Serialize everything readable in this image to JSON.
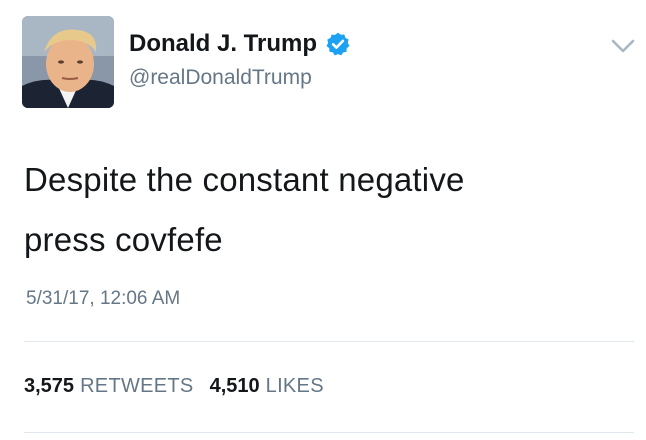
{
  "tweet": {
    "author": {
      "name": "Donald J. Trump",
      "handle": "@realDonaldTrump",
      "verified": true
    },
    "text_lines": [
      "Despite the constant negative",
      "press covfefe"
    ],
    "timestamp": "5/31/17, 12:06 AM",
    "stats": {
      "retweets_count": "3,575",
      "retweets_label": "RETWEETS",
      "likes_count": "4,510",
      "likes_label": "LIKES"
    }
  },
  "colors": {
    "verified_badge": "#1da1f2",
    "text_primary": "#14171a",
    "text_secondary": "#657786",
    "divider": "#e1e8ed"
  },
  "icons": {
    "verified": "verified-badge-icon",
    "menu": "chevron-down-icon"
  }
}
